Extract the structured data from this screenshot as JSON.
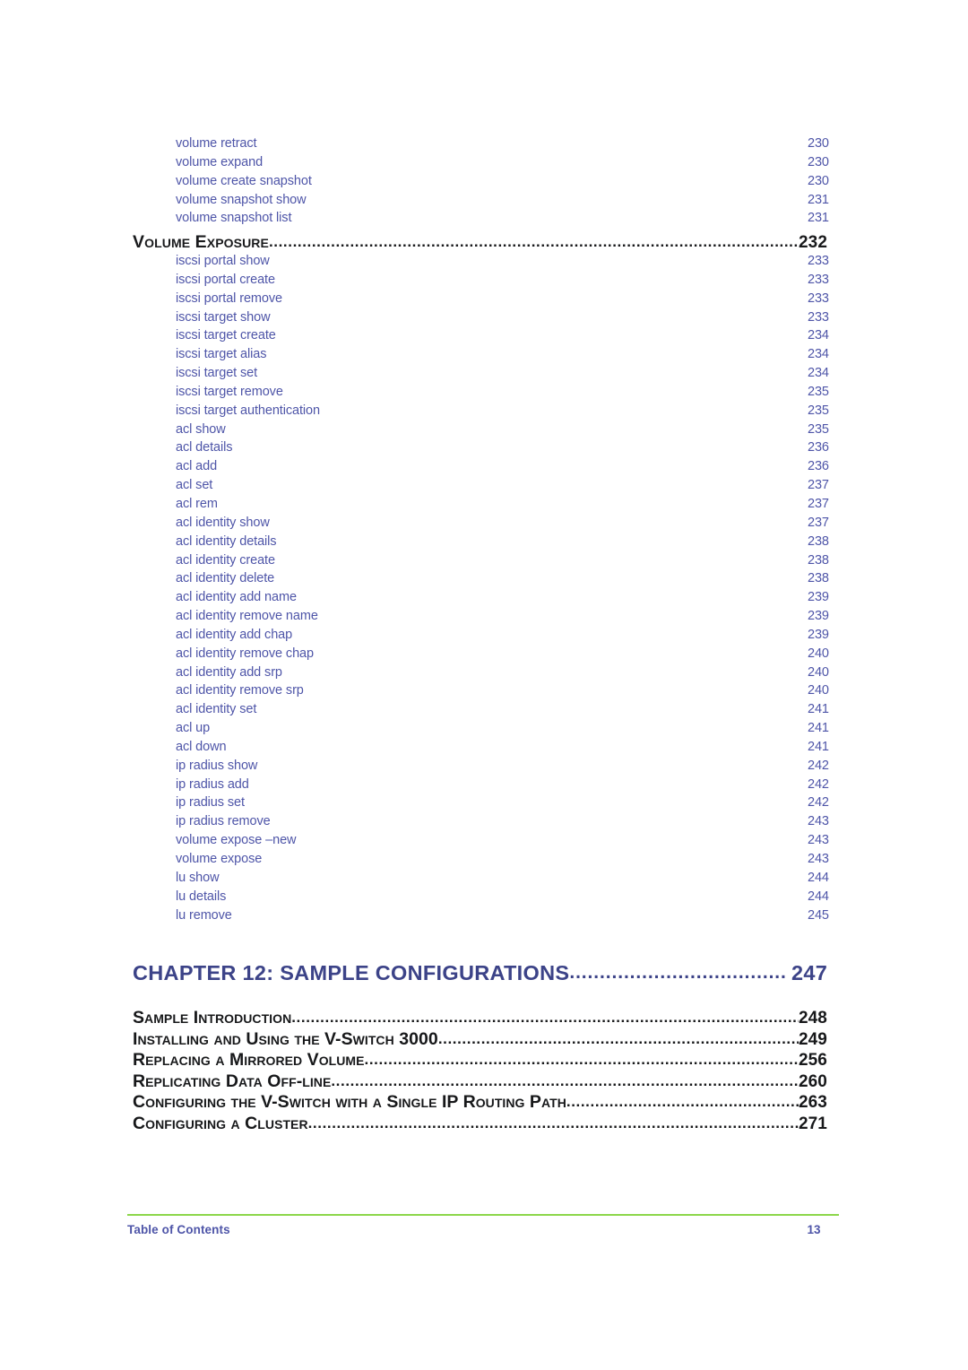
{
  "document": {
    "page_number": "13",
    "footer_label": "Table of Contents",
    "rule_color": "#8cd64a",
    "entry_color": "#4e55a8",
    "heading_color": "#17181a",
    "chapter_color": "#3c4388"
  },
  "toc_group_1": {
    "entries": [
      {
        "label": "volume retract",
        "page": "230"
      },
      {
        "label": "volume expand",
        "page": "230"
      },
      {
        "label": "volume create snapshot",
        "page": "230"
      },
      {
        "label": "volume snapshot show",
        "page": "231"
      },
      {
        "label": "volume snapshot list",
        "page": "231"
      }
    ]
  },
  "volume_exposure_heading": {
    "label": "Volume Exposure",
    "page": "232",
    "leader": "................................................................................................................"
  },
  "toc_group_2": {
    "entries": [
      {
        "label": "iscsi portal show",
        "page": "233"
      },
      {
        "label": "iscsi portal create",
        "page": "233"
      },
      {
        "label": "iscsi portal remove",
        "page": "233"
      },
      {
        "label": "iscsi target show",
        "page": "233"
      },
      {
        "label": "iscsi target create",
        "page": "234"
      },
      {
        "label": "iscsi target alias",
        "page": "234"
      },
      {
        "label": "iscsi target set",
        "page": "234"
      },
      {
        "label": "iscsi target remove",
        "page": "235"
      },
      {
        "label": "iscsi target authentication",
        "page": "235"
      },
      {
        "label": "acl show",
        "page": "235"
      },
      {
        "label": "acl details",
        "page": "236"
      },
      {
        "label": "acl add",
        "page": "236"
      },
      {
        "label": "acl set",
        "page": "237"
      },
      {
        "label": "acl rem",
        "page": "237"
      },
      {
        "label": "acl identity show",
        "page": "237"
      },
      {
        "label": "acl identity details",
        "page": "238"
      },
      {
        "label": "acl identity create",
        "page": "238"
      },
      {
        "label": "acl identity delete",
        "page": "238"
      },
      {
        "label": "acl identity add name",
        "page": "239"
      },
      {
        "label": "acl identity remove name",
        "page": "239"
      },
      {
        "label": "acl identity add chap",
        "page": "239"
      },
      {
        "label": "acl identity remove chap",
        "page": "240"
      },
      {
        "label": "acl identity add srp",
        "page": "240"
      },
      {
        "label": "acl identity remove srp",
        "page": "240"
      },
      {
        "label": "acl identity set",
        "page": "241"
      },
      {
        "label": "acl up",
        "page": "241"
      },
      {
        "label": "acl down",
        "page": "241"
      },
      {
        "label": "ip radius show",
        "page": "242"
      },
      {
        "label": "ip radius add",
        "page": "242"
      },
      {
        "label": "ip radius set",
        "page": "242"
      },
      {
        "label": "ip radius remove",
        "page": "243"
      },
      {
        "label": "volume expose –new",
        "page": "243"
      },
      {
        "label": "volume expose",
        "page": "243"
      },
      {
        "label": "lu show",
        "page": "244"
      },
      {
        "label": "lu details",
        "page": "244"
      },
      {
        "label": "lu remove",
        "page": "245"
      }
    ]
  },
  "chapter": {
    "label": "CHAPTER 12:  SAMPLE CONFIGURATIONS",
    "page": "247",
    "leader": "......................................."
  },
  "chapter_sections": {
    "entries": [
      {
        "label": "Sample Introduction",
        "page": "248",
        "leader": "................................................................................................."
      },
      {
        "label": "Installing and Using the V-Switch 3000",
        "page": "249",
        "leader": "..........................................................................."
      },
      {
        "label": "Replacing a Mirrored Volume",
        "page": "256",
        "leader": "............................................................................................"
      },
      {
        "label": "Replicating Data Off-line",
        "page": "260",
        "leader": "..............................................................................................."
      },
      {
        "label": "Configuring the V-Switch with a Single IP Routing Path",
        "page": "263",
        "leader": "...................................."
      },
      {
        "label": "Configuring a Cluster",
        "page": "271",
        "leader": "..................................................................................................."
      }
    ]
  }
}
